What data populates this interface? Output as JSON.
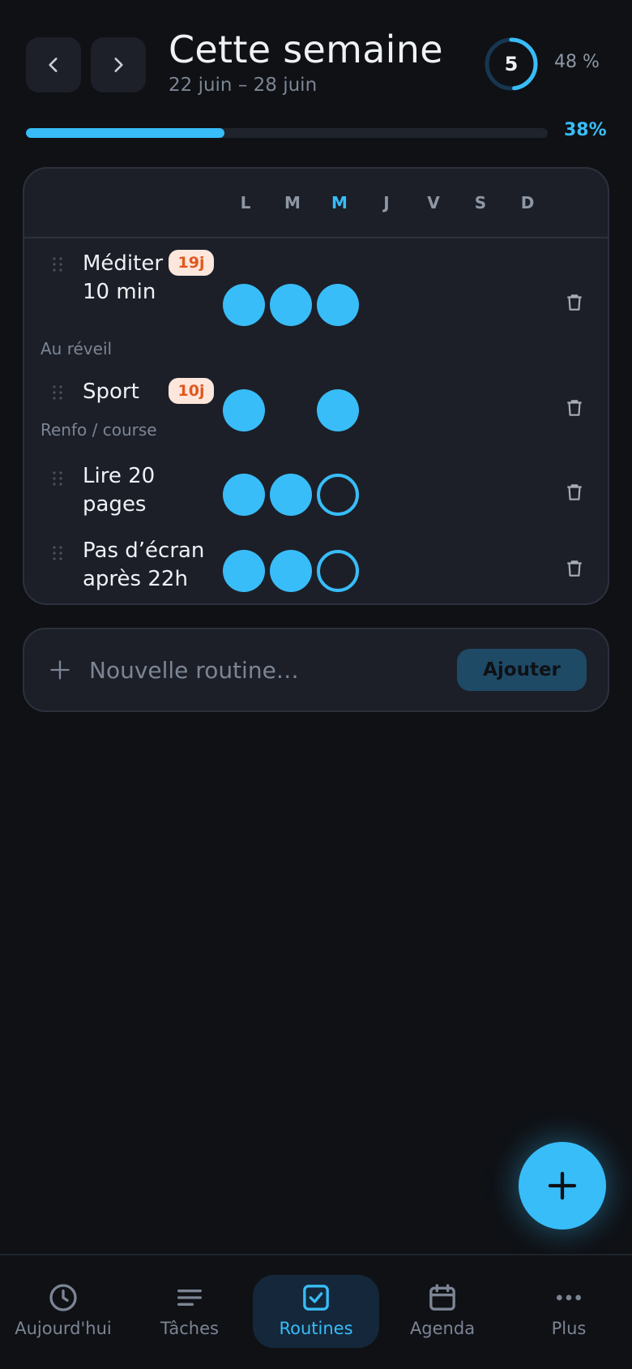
{
  "header": {
    "title": "Cette semaine",
    "date_range": "22 juin – 28 juin",
    "ring_value": "5",
    "ring_fraction": 0.48,
    "ring_percent": "48 %",
    "progress_fraction": 0.38,
    "progress_label": "38%"
  },
  "days": [
    "L",
    "M",
    "M",
    "J",
    "V",
    "S",
    "D"
  ],
  "today_index": 2,
  "routines": [
    {
      "name": "Méditer 10 min",
      "sub": "Au réveil",
      "streak": "19j",
      "status": [
        "done",
        "done",
        "done",
        "empty",
        "empty",
        "empty",
        "empty"
      ]
    },
    {
      "name": "Sport",
      "sub": "Renfo / course",
      "streak": "10j",
      "status": [
        "done",
        "empty",
        "done",
        "empty",
        "empty",
        "empty",
        "empty"
      ]
    },
    {
      "name": "Lire 20 pages",
      "sub": "",
      "streak": "",
      "status": [
        "done",
        "done",
        "todo",
        "empty",
        "empty",
        "empty",
        "empty"
      ]
    },
    {
      "name": "Pas d’écran après 22h",
      "sub": "",
      "streak": "",
      "status": [
        "done",
        "done",
        "todo",
        "empty",
        "empty",
        "empty",
        "empty"
      ]
    }
  ],
  "add_routine": {
    "placeholder": "Nouvelle routine…",
    "button_label": "Ajouter"
  },
  "bottom_nav": [
    {
      "label": "Aujourd'hui",
      "icon": "clock-icon"
    },
    {
      "label": "Tâches",
      "icon": "list-icon"
    },
    {
      "label": "Routines",
      "icon": "check-square-icon",
      "active": true
    },
    {
      "label": "Agenda",
      "icon": "calendar-icon"
    },
    {
      "label": "Plus",
      "icon": "more-icon"
    }
  ],
  "colors": {
    "accent": "#38bdf8",
    "background": "#0f1115",
    "card": "#1c1f28",
    "streak_bg": "#fde6dc",
    "streak_text": "#e0581e"
  }
}
